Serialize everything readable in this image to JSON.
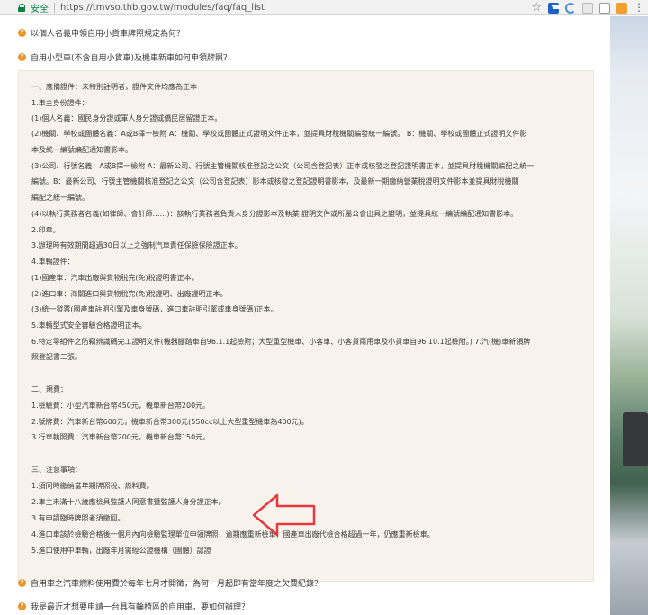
{
  "browser": {
    "secure_label": "安全",
    "url": "https://tmvso.thb.gov.tw/modules/faq/faq_list",
    "icons": [
      "lock-icon",
      "star-icon",
      "download-extension-icon",
      "loading-icon",
      "extension-icon",
      "cat-extension-icon",
      "orange-extension-icon",
      "menu-icon"
    ]
  },
  "faq": {
    "q1": "以個人名義申領自用小貨車牌照規定為何？",
    "q2": "自用小型車(不含自用小貨車)及機車新車如何申領牌照？",
    "q3": "自用車之汽車燃料使用費於每年七月才開徵，為何一月起即有當年度之欠費紀錄？",
    "q4": "我是最近才想要申請一台具有輪椅區的自用車，要如何辦理？"
  },
  "answer": {
    "lines": [
      "一、應備證件：未特別註明者，證件文件均應為正本",
      "1.車主身份證件：",
      "(1)個人名義：國民身分證或軍人身分證或僑民居留證正本。",
      "(2)機關、學校或團體名義：A或B擇一檢附 A：機關、學校或團體正式證明文件正本，並提具財稅機關編發統一編號。 B：機關、學校或團體正式證明文件影",
      "本及統一編號編配通知書影本。",
      "(3)公司、行號名義：A或B擇一檢附 A：最新公司、行號主管機關核准登記之公文（公司含登記表）正本或核發之登記證明書正本，並提具財稅機關編配之統一",
      "編號。B：最新公司、行號主管機關核准登記之公文（公司含登記表）影本或核發之登記證明書影本，及最新一期繳納營業稅證明文件影本並提具財稅機關",
      "編配之統一編號。",
      "(4)以執行業務者名義(如律師、會計師……)：該執行業務者負責人身分證影本及執業     證明文件或所屬公會出具之證明，並提具統一編號編配通知書影本。",
      "2.印章。",
      "3.辦理時有效期間超過30日以上之強制汽車責任保險保險證正本。",
      "4.車輛證件：",
      "(1)國產車：汽車出廠與貨物稅完(免)稅證明書正本。",
      "(2)進口車：海關進口與貨物稅完(免)稅證明、出廠證明正本。",
      "(3)統一發票(國產車註明引擎及車身號碼，進口車註明引擎或車身號碼)正本。",
      "5.車輛型式安全審驗合格證明正本。",
      "6.特定零組件之防竊辨識碼完工證明文件(機器腳踏車自96.1.1起檢附；大型重型機車、小客車、小客貨兩用車及小貨車自96.10.1起檢附。) 7.汽(機)車新領牌",
      "照登記書二張。",
      "二、規費：",
      "1.檢驗費：小型汽車新台幣450元，機車新台幣200元。",
      "2.號牌費：汽車新台幣600元，機車新台幣300元(550cc以上大型重型機車為400元)。",
      "3.行車執照費：汽車新台幣200元，機車新台幣150元。",
      "三、注意事項：",
      "1.須同時繳納當年期牌照稅、燃料費。",
      "2.車主未滿十八歲應檢具監護人同意書暨監護人身分證正本。",
      "3.有申請臨時牌照者須繳回。",
      "4.進口車該於檢驗合格後一個月內向檢驗監理單位申領牌照，逾期應重新檢車，國產車出廠代檢合格超過一年，仍應重新檢車。",
      "5.進口使用中車輛，出廠年月需經公證機構（團體）認證"
    ]
  },
  "colors": {
    "bullet": "#e8962a",
    "secure": "#0b8043",
    "arrow": "#e8383d",
    "answer_bg": "#f7f3ec"
  }
}
